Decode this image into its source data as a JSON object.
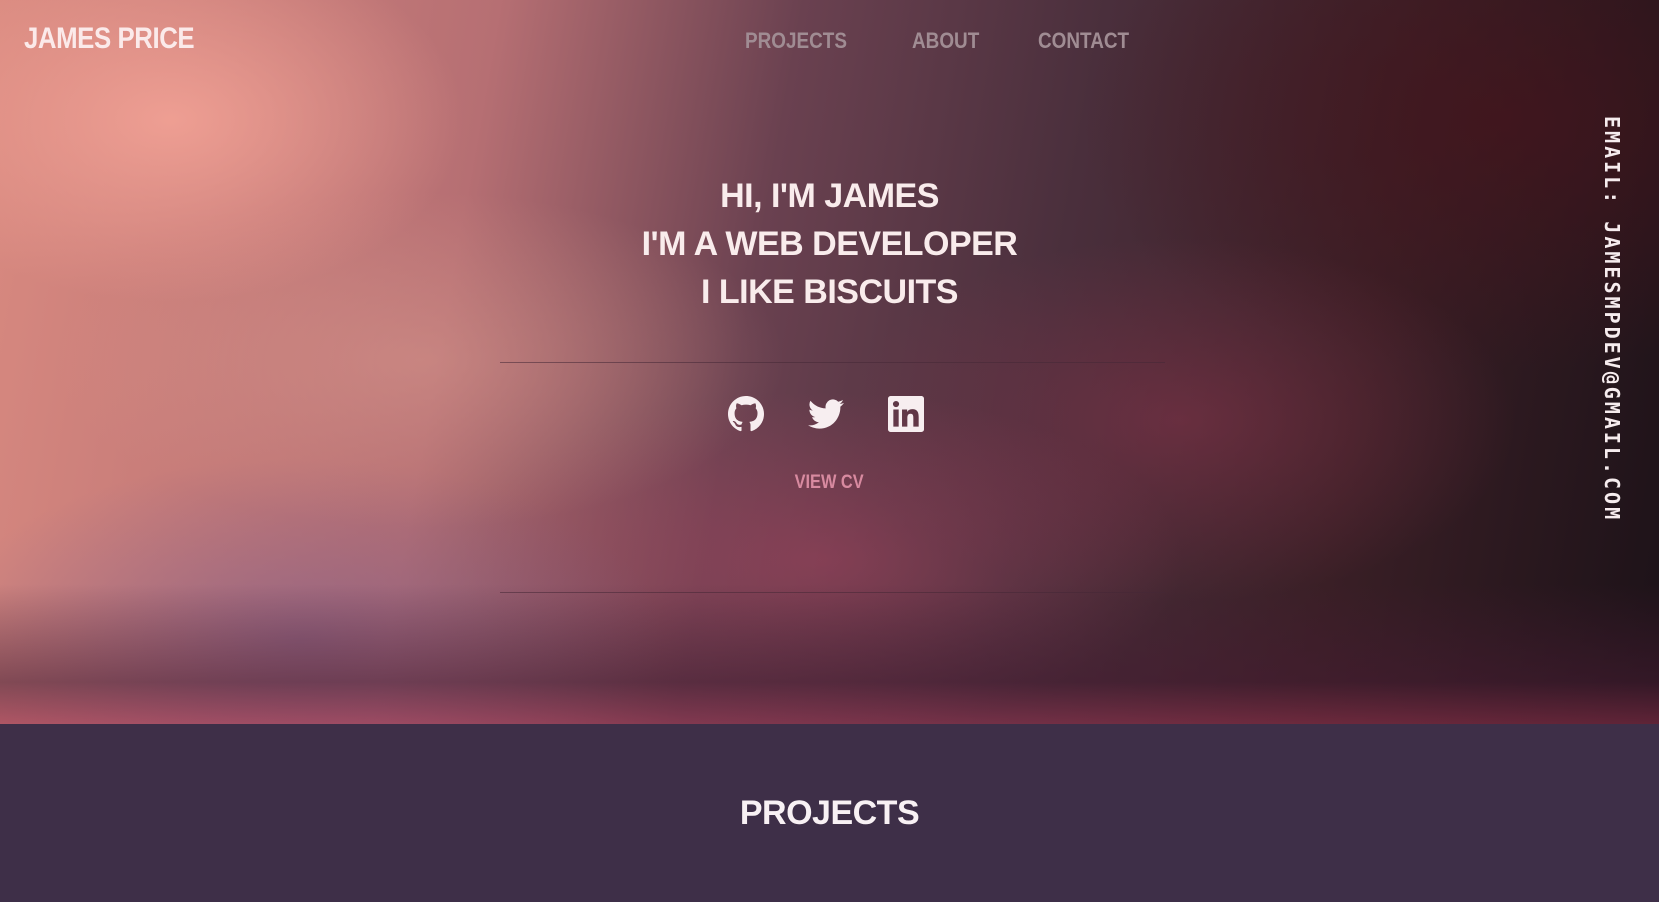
{
  "header": {
    "brand": "JAMES PRICE",
    "nav": [
      "PROJECTS",
      "ABOUT",
      "CONTACT"
    ]
  },
  "email": "EMAIL: JAMESMPDEV@GMAIL.COM",
  "intro": {
    "lines": [
      "HI, I'M JAMES",
      "I'M A WEB DEVELOPER",
      "I LIKE BISCUITS"
    ]
  },
  "socials": [
    {
      "icon": "github-icon"
    },
    {
      "icon": "twitter-icon"
    },
    {
      "icon": "linkedin-icon"
    }
  ],
  "cv_link": "VIEW CV",
  "projects": {
    "title": "PROJECTS"
  },
  "colors": {
    "brand_text": "#fbeaea",
    "nav_text": "#a08c93",
    "cv_link": "#d88aa0",
    "section_bg": "#3e2f48"
  }
}
